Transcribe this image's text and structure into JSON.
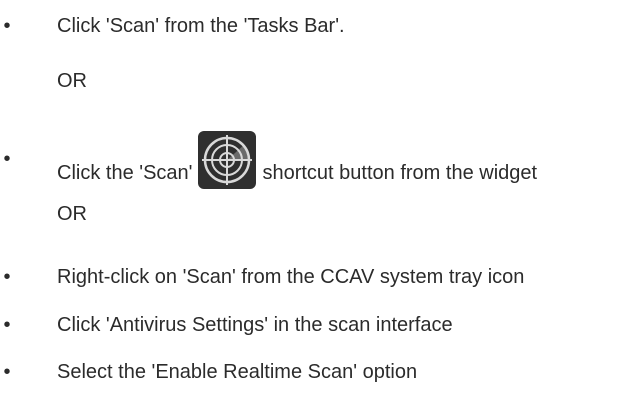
{
  "steps": [
    {
      "text": "Click 'Scan' from the 'Tasks Bar'."
    },
    {
      "or": "OR"
    },
    {
      "text_before": "Click the 'Scan'",
      "icon": "scan-target-icon",
      "text_after": "shortcut button from the widget"
    },
    {
      "or": "OR"
    },
    {
      "text": "Right-click on 'Scan' from the CCAV system tray icon"
    },
    {
      "text": "Click 'Antivirus Settings' in the scan interface"
    },
    {
      "text": "Select the 'Enable Realtime Scan' option"
    }
  ],
  "bullet": "•",
  "colors": {
    "text": "#2b2b2b",
    "icon_bg": "#2f2f2f",
    "icon_fg": "#d9d9d9"
  }
}
